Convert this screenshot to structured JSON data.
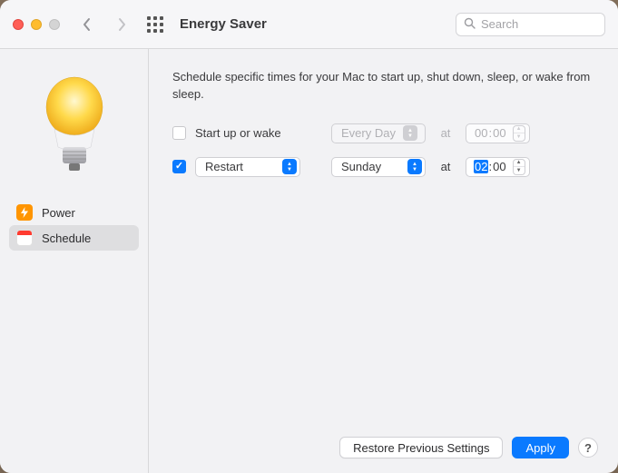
{
  "title": "Energy Saver",
  "search": {
    "placeholder": "Search"
  },
  "sidebar": {
    "items": [
      {
        "label": "Power",
        "selected": false
      },
      {
        "label": "Schedule",
        "selected": true
      }
    ]
  },
  "main": {
    "description": "Schedule specific times for your Mac to start up, shut down, sleep, or wake from sleep.",
    "row1": {
      "checked": false,
      "label": "Start up or wake",
      "frequency": "Every Day",
      "at": "at",
      "time_hh": "00",
      "time_mm": "00"
    },
    "row2": {
      "checked": true,
      "action": "Restart",
      "frequency": "Sunday",
      "at": "at",
      "time_hh": "02",
      "time_mm": "00"
    }
  },
  "footer": {
    "restore": "Restore Previous Settings",
    "apply": "Apply",
    "help": "?"
  }
}
